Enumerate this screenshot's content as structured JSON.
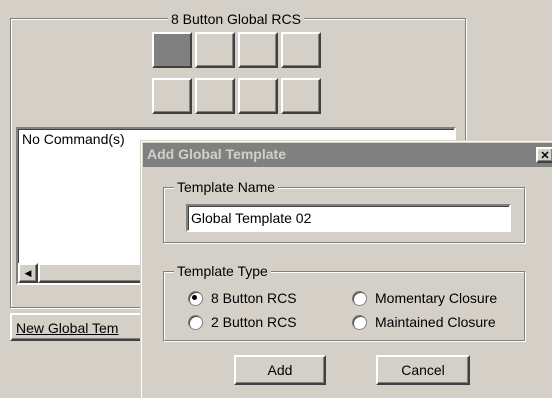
{
  "rcs_group": {
    "title": "8 Button Global RCS",
    "selected_button_index": 1
  },
  "command_list": {
    "text": "No Command(s)"
  },
  "scrollbar": {
    "left_arrow": "◀"
  },
  "new_template_button": {
    "label": "New Global Tem"
  },
  "dialog": {
    "title": "Add Global Template",
    "close_glyph": "✕",
    "name_group_title": "Template Name",
    "name_value": "Global Template 02",
    "type_group_title": "Template Type",
    "options": [
      {
        "label": "8 Button RCS",
        "checked": true
      },
      {
        "label": "Momentary Closure",
        "checked": false
      },
      {
        "label": "2 Button RCS",
        "checked": false
      },
      {
        "label": "Maintained Closure",
        "checked": false
      }
    ],
    "add_label": "Add",
    "cancel_label": "Cancel"
  }
}
